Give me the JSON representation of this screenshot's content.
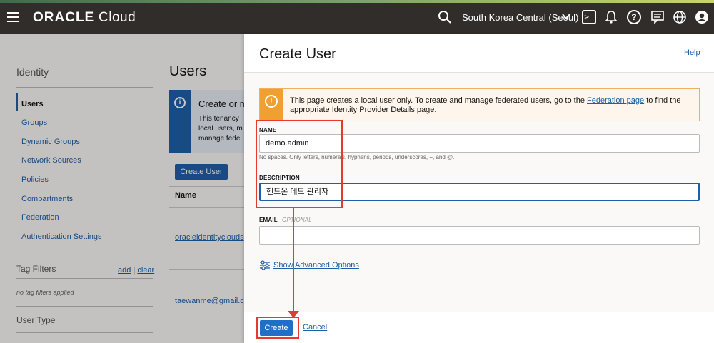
{
  "header": {
    "logo_brand": "ORACLE",
    "logo_product": "Cloud",
    "region": "South Korea Central (Seoul)",
    "icons": [
      "menu-icon",
      "search-icon",
      "chevron-down-icon",
      "cloud-shell-icon",
      "bell-icon",
      "help-icon",
      "chat-icon",
      "globe-icon",
      "user-icon"
    ]
  },
  "sidebar": {
    "section": "Identity",
    "items": [
      {
        "label": "Users",
        "active": true
      },
      {
        "label": "Groups"
      },
      {
        "label": "Dynamic Groups"
      },
      {
        "label": "Network Sources"
      },
      {
        "label": "Policies"
      },
      {
        "label": "Compartments"
      },
      {
        "label": "Federation"
      },
      {
        "label": "Authentication Settings"
      }
    ],
    "tag_filters": "Tag Filters",
    "tag_add": "add",
    "tag_sep": "|",
    "tag_clear": "clear",
    "no_tags": "no tag filters applied",
    "user_type": "User Type"
  },
  "users_page": {
    "title": "Users",
    "info_title": "Create or m",
    "info_lines": [
      "This tenancy",
      "local users, m",
      "manage fede"
    ],
    "create_user_button": "Create User",
    "table_header": "Name",
    "rows": [
      "oracleidentityclouds",
      "taewanme@gmail.co"
    ]
  },
  "panel": {
    "title": "Create User",
    "help": "Help",
    "warning_text_before": "This page creates a local user only. To create and manage federated users, go to the ",
    "warning_link": "Federation page",
    "warning_text_after": " to find the appropriate Identity Provider Details page.",
    "name_label": "NAME",
    "name_value": "demo.admin",
    "name_hint": "No spaces. Only letters, numerals, hyphens, periods, underscores, +, and @.",
    "description_label": "DESCRIPTION",
    "description_value": "핸드온 데모 관리자",
    "email_label": "EMAIL",
    "email_optional": "OPTIONAL",
    "email_value": "",
    "advanced_options": "Show Advanced Options",
    "create_button": "Create",
    "cancel_link": "Cancel"
  },
  "colors": {
    "topbar": "#312d2a",
    "accent": "#1f5fa8",
    "warning": "#f0a030",
    "annotation": "#e53b2f"
  }
}
